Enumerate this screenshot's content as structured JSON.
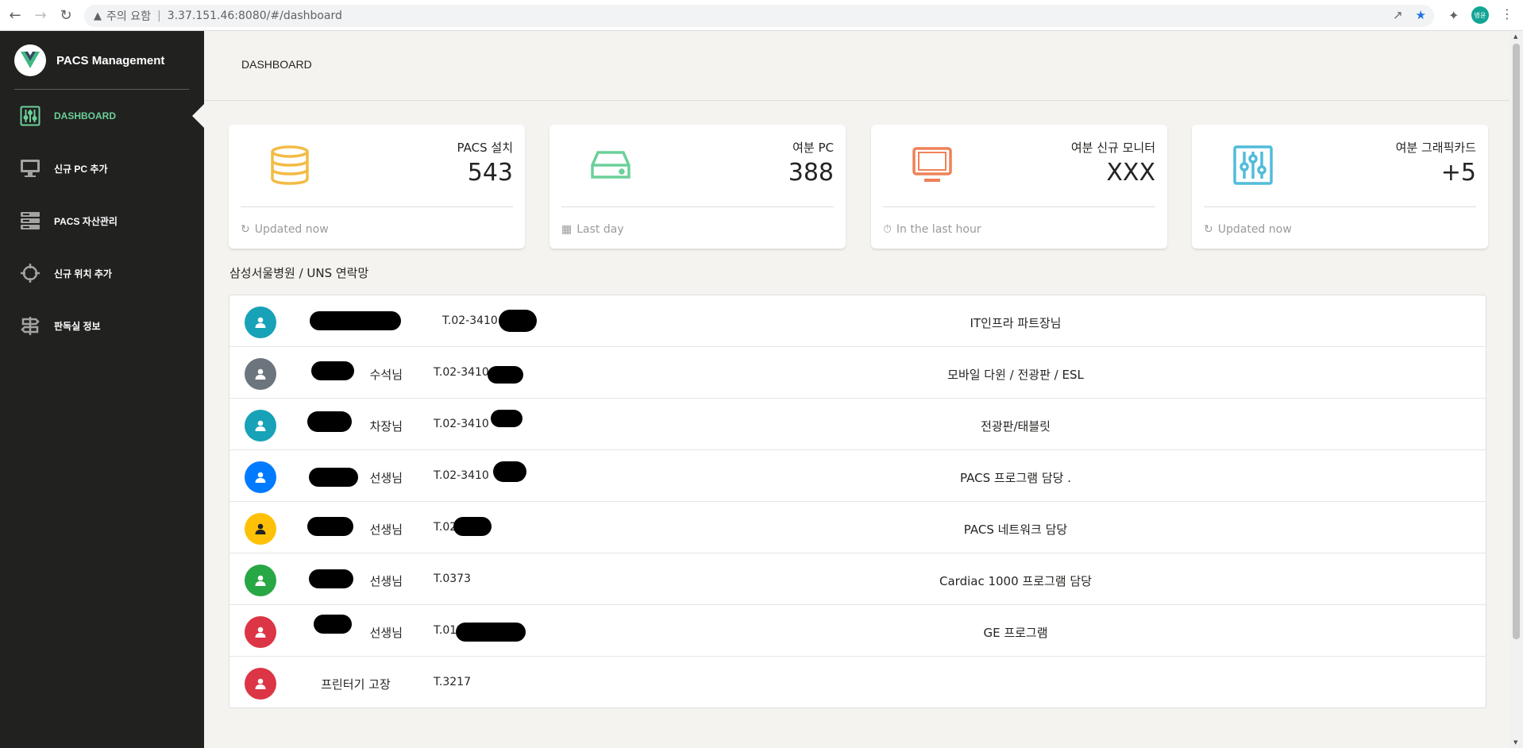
{
  "browser": {
    "warning_text": "주의 요함",
    "url": "3.37.151.46:8080/#/dashboard",
    "profile_initials": "병윤"
  },
  "sidebar": {
    "brand": "PACS Management",
    "items": [
      {
        "label": "DASHBOARD",
        "icon": "equalizer-icon",
        "active": true
      },
      {
        "label": "신규 PC 추가",
        "icon": "desktop-icon",
        "active": false
      },
      {
        "label": "PACS 자산관리",
        "icon": "server-icon",
        "active": false
      },
      {
        "label": "신규 위치 추가",
        "icon": "crosshair-icon",
        "active": false
      },
      {
        "label": "판독실 정보",
        "icon": "signpost-icon",
        "active": false
      }
    ]
  },
  "header": {
    "title": "DASHBOARD"
  },
  "stats": [
    {
      "label": "PACS 설치",
      "value": "543",
      "footer": "Updated now",
      "icon": "database-icon",
      "footer_icon": "refresh-icon",
      "color": "#f3bb45"
    },
    {
      "label": "여분 PC",
      "value": "388",
      "footer": "Last day",
      "icon": "hard-drive-icon",
      "footer_icon": "calendar-icon",
      "color": "#6bd098"
    },
    {
      "label": "여분 신규 모니터",
      "value": "XXX",
      "footer": "In the last hour",
      "icon": "monitor-icon",
      "footer_icon": "clock-icon",
      "color": "#ef8157"
    },
    {
      "label": "여분 그래픽카드",
      "value": "+5",
      "footer": "Updated now",
      "icon": "sliders-icon",
      "footer_icon": "refresh-icon",
      "color": "#51bcda"
    }
  ],
  "contacts": {
    "title": "삼성서울병원 / UNS 연락망",
    "rows": [
      {
        "name": "",
        "phone": "T.02-3410",
        "role": "IT인프라 파트장님",
        "avatar_color": "#17a2b8"
      },
      {
        "name": "수석님",
        "phone": "T.02-3410",
        "role": "모바일 다윈 / 전광판 / ESL",
        "avatar_color": "#6c757d"
      },
      {
        "name": "차장님",
        "phone": "T.02-3410",
        "role": "전광판/태블릿",
        "avatar_color": "#17a2b8"
      },
      {
        "name": "선생님",
        "phone": "T.02-3410",
        "role": "PACS 프로그램 담당 .",
        "avatar_color": "#007bff"
      },
      {
        "name": "선생님",
        "phone": "T.02-9871",
        "role": "PACS 네트워크 담당",
        "avatar_color": "#ffc107"
      },
      {
        "name": "선생님",
        "phone": "T.0373",
        "role": "Cardiac 1000 프로그램 담당",
        "avatar_color": "#28a745"
      },
      {
        "name": "선생님",
        "phone": "T.012",
        "role": "GE 프로그램",
        "avatar_color": "#dc3545"
      },
      {
        "name": "프린터기 고장",
        "phone": "T.3217",
        "role": "",
        "avatar_color": "#dc3545"
      }
    ]
  }
}
